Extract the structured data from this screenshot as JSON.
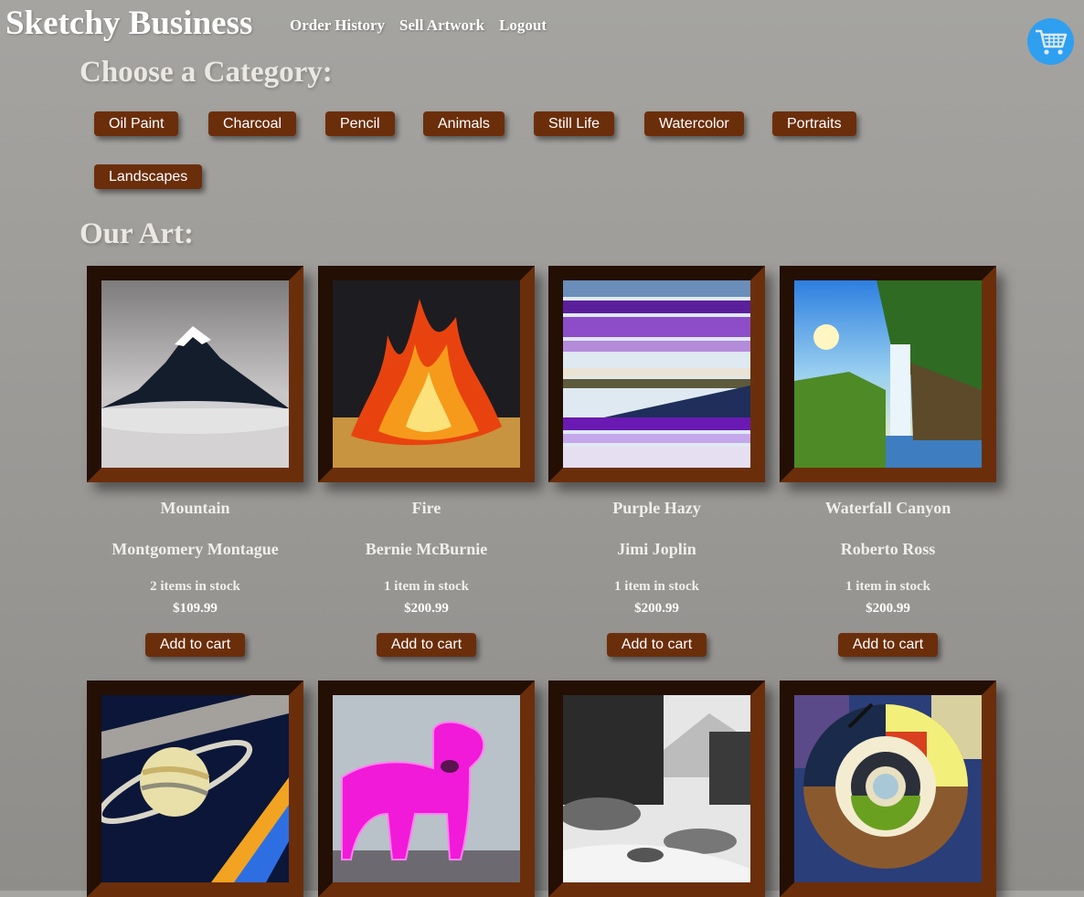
{
  "header": {
    "site_title": "Sketchy Business",
    "nav": [
      "Order History",
      "Sell Artwork",
      "Logout"
    ],
    "cart_icon": "shopping-cart-icon",
    "cart_color": "#2f9ff0"
  },
  "categories": {
    "heading": "Choose a Category:",
    "items": [
      "Oil Paint",
      "Charcoal",
      "Pencil",
      "Animals",
      "Still Life",
      "Watercolor",
      "Portraits",
      "Landscapes"
    ]
  },
  "art": {
    "heading": "Our Art:",
    "add_label": "Add to cart",
    "items": [
      {
        "title": "Mountain",
        "artist": "Montgomery Montague",
        "stock": "2 items in stock",
        "price": "$109.99"
      },
      {
        "title": "Fire",
        "artist": "Bernie McBurnie",
        "stock": "1 item in stock",
        "price": "$200.99"
      },
      {
        "title": "Purple Hazy",
        "artist": "Jimi Joplin",
        "stock": "1 item in stock",
        "price": "$200.99"
      },
      {
        "title": "Waterfall Canyon",
        "artist": "Roberto Ross",
        "stock": "1 item in stock",
        "price": "$200.99"
      }
    ]
  },
  "colors": {
    "button": "#6b2e0b",
    "frame_dark": "#230f03"
  }
}
